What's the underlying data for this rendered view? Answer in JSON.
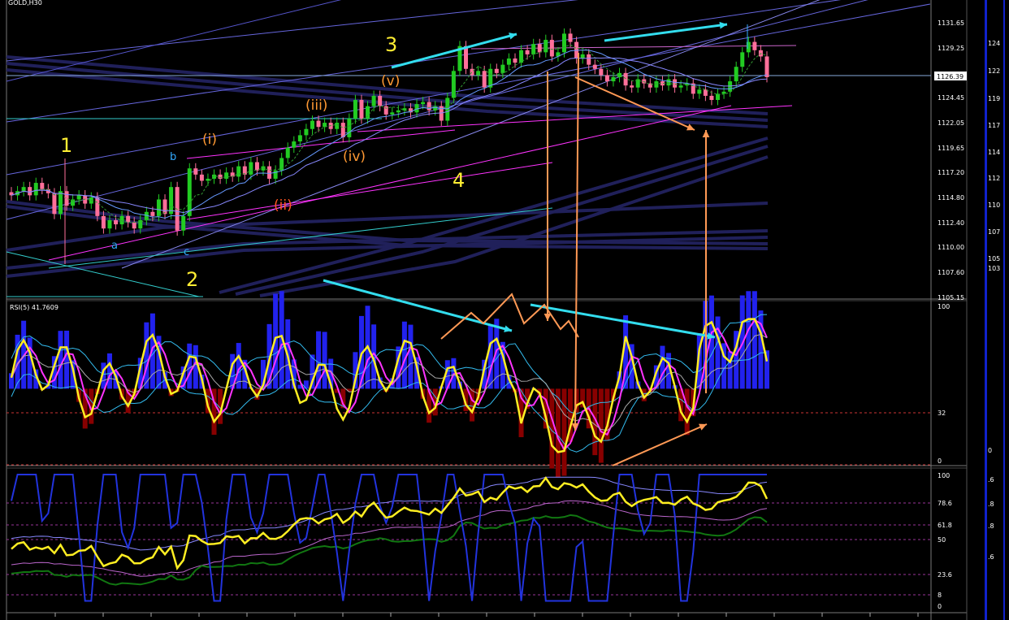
{
  "colors": {
    "background": "#000000",
    "bull_candle": "#22cc22",
    "bear_candle": "#ff6f9a",
    "channel_blue": "#7777ff",
    "band_navy": "#20205a",
    "magenta": "#ff33ff",
    "teal": "#33cccc",
    "yellow": "#ffee33",
    "orange": "#ff9955",
    "cyan_arrow": "#33ddee",
    "hist_positive": "#2222ee",
    "hist_negative": "#880000",
    "rsi_line": "#ffee22",
    "stoch_blue": "#2233dd",
    "stoch_green": "#117711",
    "right_edge_blue": "#1122cc"
  },
  "header": {
    "symbol_text": "GOLD,H30"
  },
  "price_panel": {
    "price_axis": [
      "1131.65",
      "1129.25",
      "1124.45",
      "1122.05",
      "1119.65",
      "1117.20",
      "1114.80",
      "1112.40",
      "1110.00",
      "1107.60",
      "1105.15"
    ],
    "current_price_label": "1126.39",
    "clipped_axis_right": [
      "124",
      "122",
      "119",
      "117",
      "114",
      "112",
      "110",
      "107",
      "105",
      "103"
    ]
  },
  "wave_labels": {
    "primary": [
      "1",
      "2",
      "3",
      "4"
    ],
    "abc": [
      "a",
      "b",
      "c"
    ],
    "minor": [
      "(i)",
      "(ii)",
      "(iii)",
      "(iv)",
      "(v)"
    ]
  },
  "rsi_panel": {
    "title": "RSI(5) 41.7609",
    "levels": [
      "100",
      "32",
      "0"
    ],
    "right_level": "0"
  },
  "stoch_panel": {
    "levels": [
      "100",
      "78.6",
      "61.8",
      "50",
      "23.6",
      "8",
      "0"
    ],
    "right_levels": [
      ".6",
      ".8",
      ".8",
      ".6"
    ]
  },
  "chart_data": {
    "type": "line",
    "ylim": [
      1105.15,
      1131.65
    ],
    "series": [
      {
        "values": [
          1115.0,
          1115.4,
          1115.8,
          1115.0,
          1116.2,
          1115.6,
          1115.2,
          1113.2,
          1115.4,
          1114.0,
          1114.6,
          1115.0,
          1114.2,
          1114.8,
          1113.0,
          1111.8,
          1112.6,
          1112.2,
          1113.0,
          1112.4,
          1111.8,
          1112.6,
          1113.4,
          1113.0,
          1114.6,
          1113.2,
          1115.8,
          1111.6,
          1113.0,
          1117.6,
          1117.0,
          1116.4,
          1116.6,
          1117.0,
          1116.6,
          1117.2,
          1116.8,
          1117.8,
          1117.0,
          1118.2,
          1117.4,
          1117.8,
          1116.6,
          1117.4,
          1118.6,
          1119.6,
          1120.2,
          1120.8,
          1121.4,
          1122.2,
          1121.6,
          1122.0,
          1121.4,
          1122.0,
          1120.6,
          1122.4,
          1124.2,
          1122.4,
          1123.6,
          1124.6,
          1123.6,
          1122.8,
          1123.0,
          1123.2,
          1123.4,
          1123.0,
          1123.8,
          1124.0,
          1123.2,
          1123.6,
          1122.2,
          1124.4,
          1127.0,
          1129.4,
          1127.2,
          1126.6,
          1127.0,
          1125.4,
          1127.2,
          1126.8,
          1127.6,
          1128.2,
          1127.8,
          1129.0,
          1128.6,
          1129.6,
          1128.8,
          1130.0,
          1128.4,
          1128.8,
          1130.6,
          1129.8,
          1128.2,
          1128.6,
          1127.6,
          1127.2,
          1126.6,
          1126.0,
          1126.4,
          1126.8,
          1125.6,
          1125.4,
          1126.2,
          1125.8,
          1125.4,
          1126.0,
          1125.6,
          1126.2,
          1125.4,
          1125.6,
          1125.8,
          1124.8,
          1125.2,
          1124.6,
          1124.2,
          1124.8,
          1125.0,
          1126.0,
          1127.4,
          1128.8,
          1129.8,
          1129.0,
          1128.4,
          1126.4
        ]
      }
    ]
  }
}
